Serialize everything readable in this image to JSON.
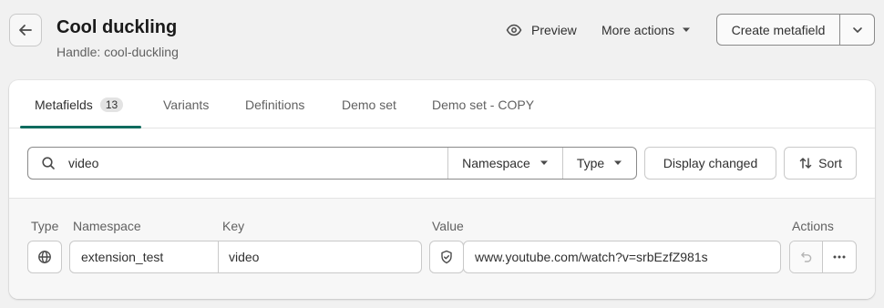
{
  "header": {
    "title": "Cool duckling",
    "handle": "Handle: cool-duckling",
    "preview_label": "Preview",
    "more_actions_label": "More actions",
    "create_label": "Create metafield"
  },
  "tabs": [
    {
      "label": "Metafields",
      "badge": "13",
      "active": true
    },
    {
      "label": "Variants"
    },
    {
      "label": "Definitions"
    },
    {
      "label": "Demo set"
    },
    {
      "label": "Demo set - COPY"
    }
  ],
  "filters": {
    "search_value": "video",
    "namespace_label": "Namespace",
    "type_label": "Type",
    "display_changed_label": "Display changed",
    "sort_label": "Sort"
  },
  "columns": {
    "type": "Type",
    "namespace": "Namespace",
    "key": "Key",
    "value": "Value",
    "actions": "Actions"
  },
  "row": {
    "type_icon": "globe-icon",
    "namespace": "extension_test",
    "key": "video",
    "value_icon": "shield-icon",
    "value": "www.youtube.com/watch?v=srbEzfZ981s"
  },
  "colors": {
    "accent": "#0f6b5e",
    "background": "#f1f1f1",
    "card": "#ffffff"
  }
}
